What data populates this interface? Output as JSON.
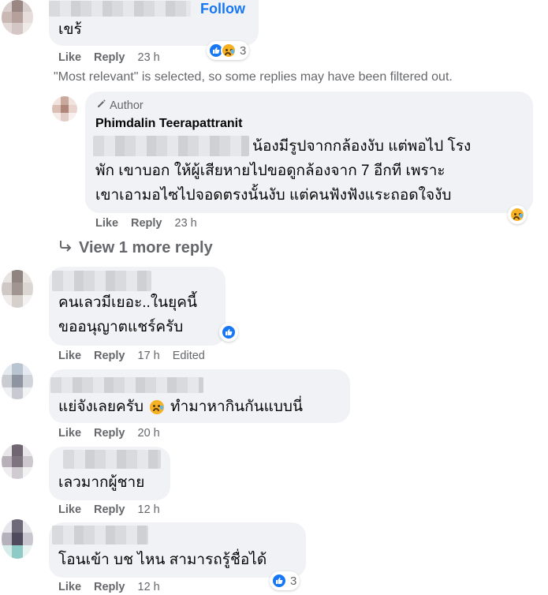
{
  "top_comment": {
    "follow_label": "Follow",
    "text": "เขร้",
    "actions": {
      "like": "Like",
      "reply": "Reply",
      "time": "23 h"
    },
    "reaction_count": "3"
  },
  "filter_notice": "\"Most relevant\" is selected, so some replies may have been filtered out.",
  "author_reply": {
    "badge": "Author",
    "name": "Phimdalin Teerapattranit",
    "line1": "น้องมีรูปจากกล้องงับ แต่พอไป โรง",
    "line2": "พัก เขาบอก ให้ผู้เสียหายไปขอดูกล้องจาก 7 อีกที เพราะ",
    "line3": "เขาเอามอไซไปจอดตรงนั้นงับ แต่คนฟังฟังแระถอดใจงับ",
    "actions": {
      "like": "Like",
      "reply": "Reply",
      "time": "23 h"
    }
  },
  "view_more": "View 1 more reply",
  "comments": [
    {
      "line1": "คนเลวมีเยอะ..ในยุคนี้",
      "line2": "ขออนุญาตแชร์ครับ",
      "actions": {
        "like": "Like",
        "reply": "Reply",
        "time": "17 h",
        "edited": "Edited"
      }
    },
    {
      "text_a": "แย่จังเลยครับ",
      "text_b": "ทำมาหากินกันแบบนี่",
      "actions": {
        "like": "Like",
        "reply": "Reply",
        "time": "20 h"
      }
    },
    {
      "text": "เลวมากผู้ชาย",
      "actions": {
        "like": "Like",
        "reply": "Reply",
        "time": "12 h"
      }
    },
    {
      "text": "โอนเข้า บช ไหน สามารถรู้ชื่อได้",
      "actions": {
        "like": "Like",
        "reply": "Reply",
        "time": "12 h"
      },
      "reaction_count": "3"
    }
  ],
  "colors": {
    "link_blue": "#1877f2",
    "bubble_bg": "#f0f2f5",
    "meta_gray": "#65676b"
  }
}
